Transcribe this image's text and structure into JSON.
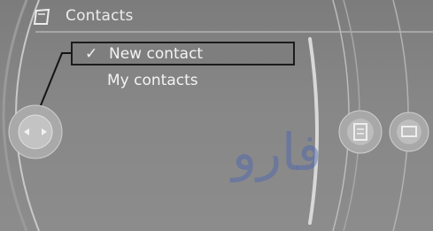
{
  "header": {
    "title": "Contacts",
    "icon": "contacts-book-icon"
  },
  "menu": {
    "items": [
      {
        "label": "New contact",
        "selected": true,
        "check": "✓"
      },
      {
        "label": "My contacts",
        "selected": false
      }
    ]
  },
  "controller": {
    "icon": "controller-knob-icon"
  },
  "side_buttons": [
    {
      "icon": "document-icon"
    },
    {
      "icon": "card-icon"
    }
  ],
  "watermark": {
    "text": "فارو"
  },
  "colors": {
    "background": "#878787",
    "text": "#f3f3f3",
    "selection_border": "#1b1b1b",
    "watermark": "#4664b4"
  }
}
